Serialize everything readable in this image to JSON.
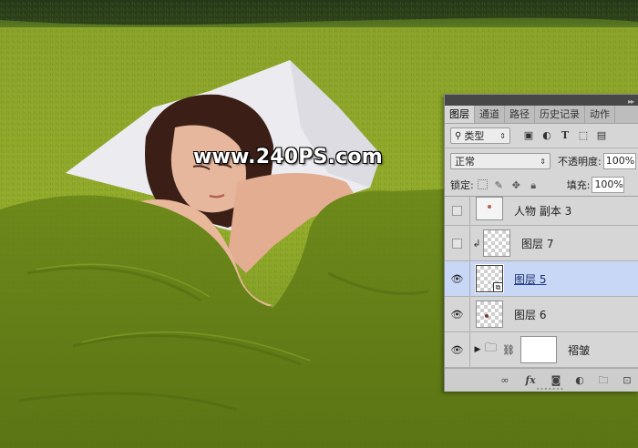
{
  "watermark": {
    "text": "www.240PS.com"
  },
  "panel": {
    "tabs": [
      {
        "label": "图层",
        "active": true
      },
      {
        "label": "通道",
        "active": false
      },
      {
        "label": "路径",
        "active": false
      },
      {
        "label": "历史记录",
        "active": false
      },
      {
        "label": "动作",
        "active": false
      }
    ],
    "filter": {
      "label": "类型",
      "icons": [
        "image-filter-icon",
        "adjustment-filter-icon",
        "type-filter-icon",
        "shape-filter-icon",
        "smart-object-filter-icon"
      ]
    },
    "blend_mode": "正常",
    "opacity_label": "不透明度:",
    "opacity_value": "100%",
    "lock_label": "锁定:",
    "fill_label": "填充:",
    "fill_value": "100%",
    "layers": [
      {
        "name": "人物 副本 3",
        "visible": false
      },
      {
        "name": "图层 7",
        "visible": false,
        "clipped": true
      },
      {
        "name": "图层 5",
        "visible": true,
        "selected": true,
        "smart_object": true
      },
      {
        "name": "图层 6",
        "visible": true
      },
      {
        "name": "褶皱",
        "visible": true,
        "group": true,
        "linked_mask": true
      }
    ]
  },
  "colors": {
    "panel_bg": "#d6d6d6",
    "selected_row": "#c7d7f5",
    "header_dark": "#474747"
  }
}
